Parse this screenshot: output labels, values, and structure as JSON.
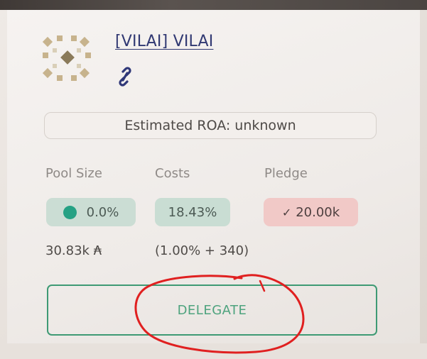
{
  "pool": {
    "name": "[VILAI] VILAI",
    "logo_icon": "pool-logo-icon",
    "link_icon": "link-icon"
  },
  "roa": {
    "text": "Estimated ROA: unknown"
  },
  "stats": {
    "pool_size": {
      "label": "Pool Size",
      "value": "0.0%",
      "sub": "30.83k ₳",
      "dot_color": "#26a184"
    },
    "costs": {
      "label": "Costs",
      "value": "18.43%",
      "sub": "(1.00% + 340)"
    },
    "pledge": {
      "label": "Pledge",
      "value": "20.00k",
      "check_icon": "check-icon",
      "status_color": "#f1c9c7"
    }
  },
  "delegate_button": {
    "label": "DELEGATE",
    "accent": "#3e9a74"
  },
  "annotation": {
    "color": "#e02020",
    "shape": "hand-drawn-circle"
  }
}
